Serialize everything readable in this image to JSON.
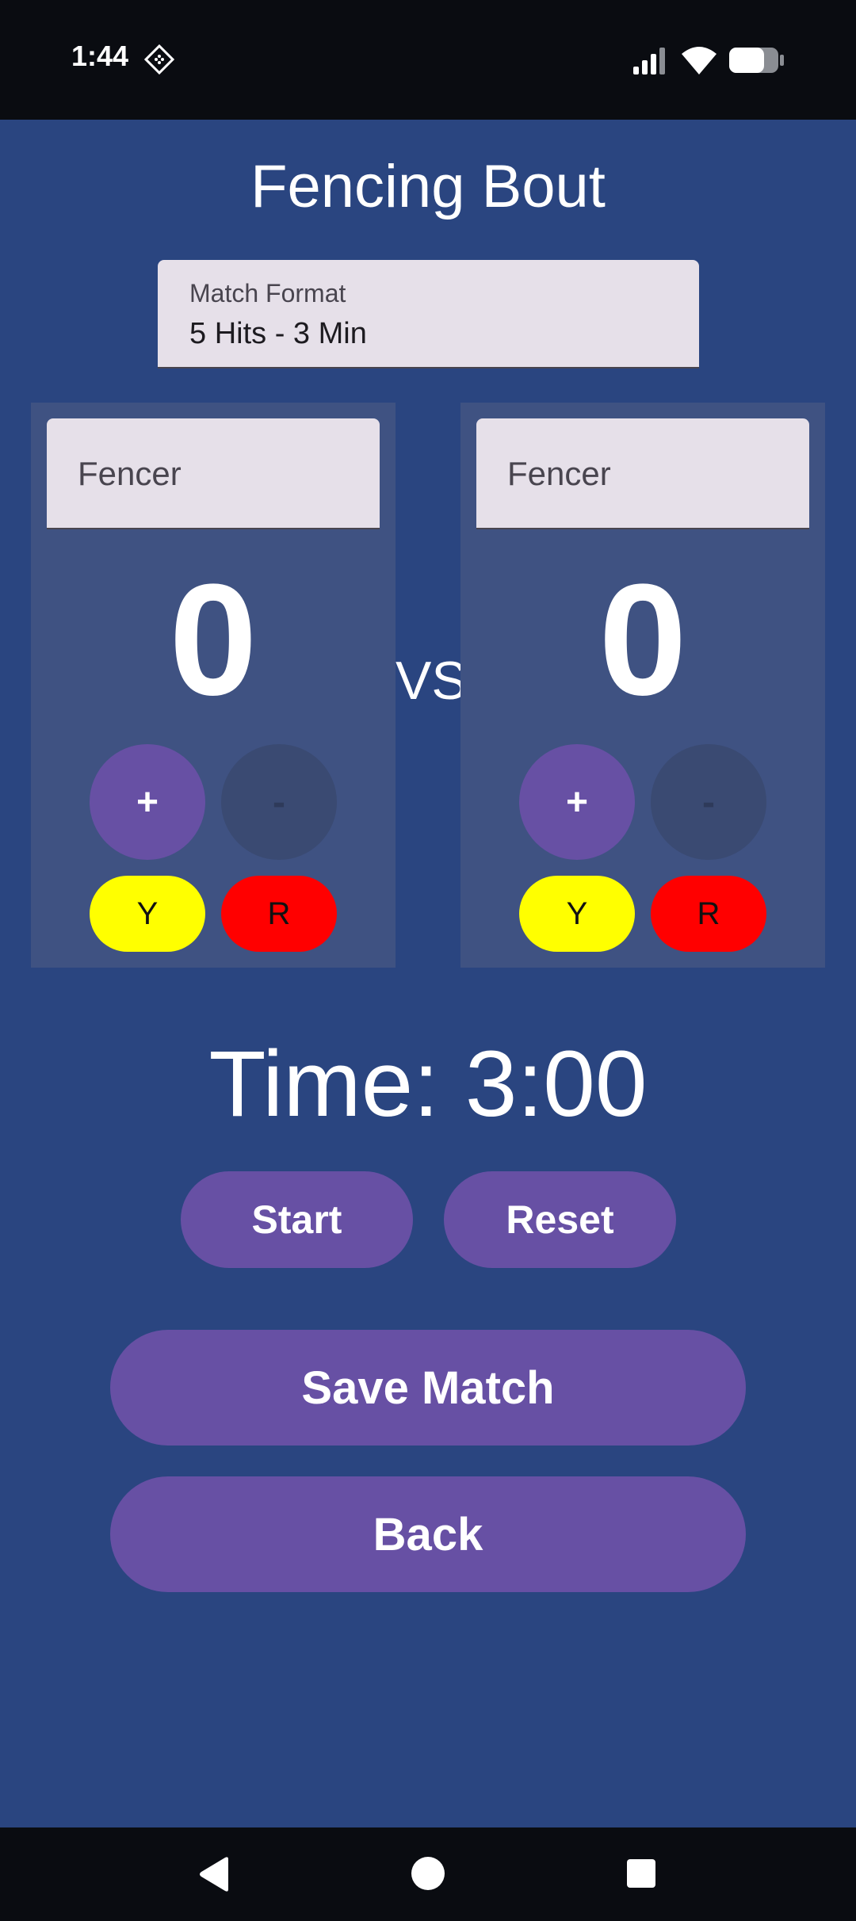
{
  "status_bar": {
    "time": "1:44",
    "icons": [
      "diamond-icon",
      "signal-icon",
      "wifi-icon",
      "battery-icon"
    ]
  },
  "title": "Fencing Bout",
  "match_format": {
    "label": "Match Format",
    "value": "5 Hits - 3 Min"
  },
  "fencers": [
    {
      "name_placeholder": "Fencer",
      "score": "0",
      "plus_label": "+",
      "minus_label": "-",
      "yellow_label": "Y",
      "red_label": "R"
    },
    {
      "name_placeholder": "Fencer",
      "score": "0",
      "plus_label": "+",
      "minus_label": "-",
      "yellow_label": "Y",
      "red_label": "R"
    }
  ],
  "vs_label": "VS",
  "timer": {
    "text": "Time: 3:00",
    "start_label": "Start",
    "reset_label": "Reset"
  },
  "actions": {
    "save_label": "Save Match",
    "back_label": "Back"
  },
  "colors": {
    "background": "#2A4580",
    "card": "#3F5282",
    "primary": "#6750A4",
    "yellow": "#FFFF00",
    "red": "#FF0000"
  }
}
